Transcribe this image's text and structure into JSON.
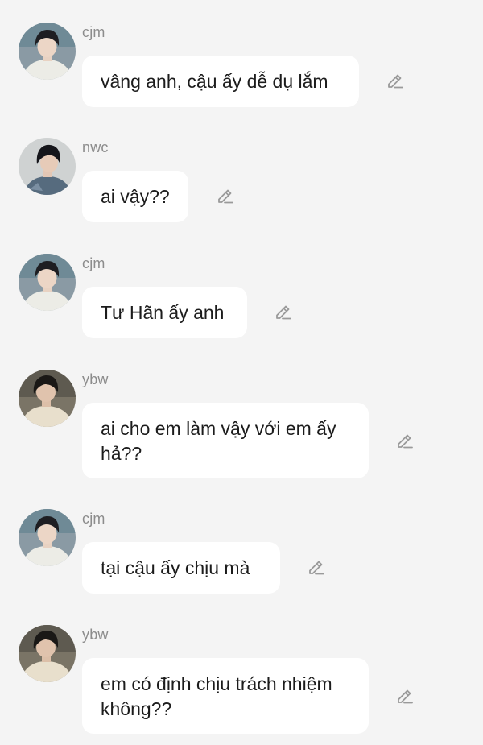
{
  "messages": [
    {
      "user": "cjm",
      "avatar_icon": "cjm-avatar",
      "text": "vâng anh, cậu ấy dễ dụ lắm"
    },
    {
      "user": "nwc",
      "avatar_icon": "nwc-avatar",
      "text": "ai vậy??"
    },
    {
      "user": "cjm",
      "avatar_icon": "cjm-avatar",
      "text": "Tư Hãn ấy anh"
    },
    {
      "user": "ybw",
      "avatar_icon": "ybw-avatar",
      "text": "ai cho em làm vậy với em ấy hả??"
    },
    {
      "user": "cjm",
      "avatar_icon": "cjm-avatar",
      "text": "tại cậu ấy chịu mà"
    },
    {
      "user": "ybw",
      "avatar_icon": "ybw-avatar",
      "text": "em có định chịu trách nhiệm không??"
    }
  ],
  "colors": {
    "background": "#f4f4f4",
    "bubble": "#ffffff",
    "username": "#8c8c8c",
    "text": "#1c1c1c",
    "edit_icon": "#9a9a9a"
  },
  "icons": {
    "edit": "pencil-edit-icon"
  }
}
